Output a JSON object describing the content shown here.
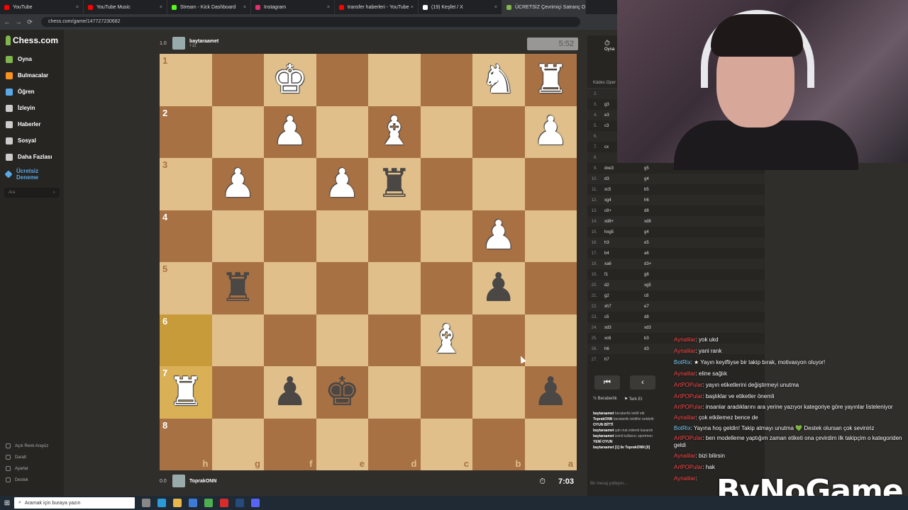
{
  "browser": {
    "tabs": [
      {
        "label": "YouTube",
        "color": "#ff0000"
      },
      {
        "label": "YouTube Music",
        "color": "#ff0000"
      },
      {
        "label": "Stream - Kick Dashboard",
        "color": "#53fc18"
      },
      {
        "label": "Instagram",
        "color": "#e1306c"
      },
      {
        "label": "transfer haberleri - YouTube",
        "color": "#ff0000"
      },
      {
        "label": "(19) Keşfet / X",
        "color": "#ffffff"
      },
      {
        "label": "ÜCRETSİZ Çevrimiçi Satranç Oy...",
        "color": "#81b64c"
      }
    ],
    "url": "chess.com/game/147727230682"
  },
  "sidebar": {
    "logo": "Chess.com",
    "items": [
      {
        "label": "Oyna",
        "color": "#81b64c"
      },
      {
        "label": "Bulmacalar",
        "color": "#f7931e"
      },
      {
        "label": "Öğren",
        "color": "#5aa9e6"
      },
      {
        "label": "İzleyin",
        "color": "#cccccc"
      },
      {
        "label": "Haberler",
        "color": "#cccccc"
      },
      {
        "label": "Sosyal",
        "color": "#cccccc"
      },
      {
        "label": "Daha Fazlası",
        "color": "#cccccc"
      }
    ],
    "trial": "Ücretsiz Deneme",
    "search_placeholder": "Ara",
    "footer": [
      "Açık Renk Arayüz",
      "Daralt",
      "Ayarlar",
      "Destek"
    ]
  },
  "players": {
    "top": {
      "rating": "1.0",
      "name": "baytaraamet",
      "extra": "+11",
      "clock": "5:52"
    },
    "bottom": {
      "rating": "0.0",
      "name": "ToprakONN",
      "clock": "7:03"
    }
  },
  "board": {
    "ranks": [
      "1",
      "2",
      "3",
      "4",
      "5",
      "6",
      "7",
      "8"
    ],
    "files": [
      "h",
      "g",
      "f",
      "e",
      "d",
      "c",
      "b",
      "a"
    ],
    "squares": [
      [
        "",
        "",
        "wK",
        "",
        "",
        "",
        "wN",
        "wR"
      ],
      [
        "",
        "",
        "wP",
        "",
        "wB",
        "",
        "",
        "wP"
      ],
      [
        "",
        "wP",
        "",
        "wP",
        "bR",
        "",
        "",
        ""
      ],
      [
        "",
        "",
        "",
        "",
        "",
        "",
        "wP",
        ""
      ],
      [
        "",
        "bR",
        "",
        "",
        "",
        "",
        "bP",
        ""
      ],
      [
        "",
        "",
        "",
        "",
        "",
        "wB",
        "",
        ""
      ],
      [
        "wR",
        "",
        "bP",
        "bK",
        "",
        "",
        "",
        "bP"
      ],
      [
        "",
        "",
        "",
        "",
        "",
        "",
        "",
        ""
      ]
    ],
    "highlight": [
      [
        5,
        0
      ],
      [
        6,
        0
      ]
    ]
  },
  "moves": {
    "top_label": "Oyna",
    "opening": "Kâdes Oper",
    "rows": [
      {
        "n": "2.",
        "w": "",
        "b": ""
      },
      {
        "n": "3.",
        "w": "g3",
        "b": ""
      },
      {
        "n": "4.",
        "w": "e3",
        "b": ""
      },
      {
        "n": "5.",
        "w": "c3",
        "b": ""
      },
      {
        "n": "6.",
        "w": "",
        "b": ""
      },
      {
        "n": "7.",
        "w": "cx",
        "b": ""
      },
      {
        "n": "8.",
        "w": "",
        "b": ""
      },
      {
        "n": "9.",
        "w": "dxe3",
        "b": "g5"
      },
      {
        "n": "10.",
        "w": "d3",
        "b": "g4"
      },
      {
        "n": "11.",
        "w": "xc5",
        "b": "b5"
      },
      {
        "n": "12.",
        "w": "xg4",
        "b": "h6"
      },
      {
        "n": "13.",
        "w": "c8+",
        "b": "d8"
      },
      {
        "n": "14.",
        "w": "xd8+",
        "b": "xd8"
      },
      {
        "n": "15.",
        "w": "hxg5",
        "b": "g4"
      },
      {
        "n": "16.",
        "w": "h3",
        "b": "e5"
      },
      {
        "n": "17.",
        "w": "b4",
        "b": "a6"
      },
      {
        "n": "18.",
        "w": "xa6",
        "b": "d3+"
      },
      {
        "n": "19.",
        "w": "f1",
        "b": "g8"
      },
      {
        "n": "20.",
        "w": "d2",
        "b": "xg5"
      },
      {
        "n": "21.",
        "w": "g2",
        "b": "c8"
      },
      {
        "n": "22.",
        "w": "xh7",
        "b": "e7"
      },
      {
        "n": "23.",
        "w": "c5",
        "b": "d8"
      },
      {
        "n": "24.",
        "w": "xd3",
        "b": "xd3"
      },
      {
        "n": "25.",
        "w": "xc6",
        "b": "b3"
      },
      {
        "n": "26.",
        "w": "h6",
        "b": "d3"
      },
      {
        "n": "27.",
        "w": "h7",
        "b": ""
      }
    ],
    "nav": [
      "⏮",
      "‹"
    ],
    "actions": [
      "Beraberlik",
      "Terk Et"
    ],
    "log": [
      {
        "user": "baytaraamet",
        "text": "beraberlik teklif etti"
      },
      {
        "user": "ToprakONN",
        "text": "beraberlik teklifini reddetti"
      },
      {
        "user": "OYUN BİTTİ",
        "text": ""
      },
      {
        "user": "baytaraamet",
        "text": "şah mat ederek kazandı"
      },
      {
        "user": "baytaraamet",
        "text": "isimli kullanıcı sportmen"
      },
      {
        "user": "YENİ OYUN",
        "text": ""
      },
      {
        "user": "baytaraamet [1] ile ToprakONN [0]",
        "text": ""
      }
    ],
    "message_placeholder": "Bir mesaj yolleyın..."
  },
  "chat": [
    {
      "user": "Aynalilar",
      "text": ": yok ukd",
      "bot": false
    },
    {
      "user": "Aynalilar",
      "text": ": yani rank",
      "bot": false
    },
    {
      "user": "BotRix",
      "text": ": ★ Yayın keyifliyse bir takip bırak, motivasyon oluyor!",
      "bot": true
    },
    {
      "user": "Aynalilar",
      "text": ": eline sağlık",
      "bot": false
    },
    {
      "user": "ArtPOPular",
      "text": ": yayın etiketlerini değiştirmeyi unutma",
      "bot": false
    },
    {
      "user": "ArtPOPular",
      "text": ": başlıklar ve etiketler önemli",
      "bot": false
    },
    {
      "user": "ArtPOPular",
      "text": ": insanlar aradıklarını ara yerine yazıyor kategoriye göre yayınlar listeleniyor",
      "bot": false
    },
    {
      "user": "Aynalilar",
      "text": ": çok etkilemez bence de",
      "bot": false
    },
    {
      "user": "BotRix",
      "text": ": Yayına hoş geldin! Takip atmayı unutma 💚 Destek olursan çok seviniriz",
      "bot": true
    },
    {
      "user": "ArtPOPular",
      "text": ": ben modelleme yaptığım zaman etiketi ona çevirdim ilk takipçim o kategoriden geldi",
      "bot": false
    },
    {
      "user": "Aynalilar",
      "text": ": bizi bilirsin",
      "bot": false
    },
    {
      "user": "ArtPOPular",
      "text": ": hak",
      "bot": false
    },
    {
      "user": "Aynalilar",
      "text": ": ",
      "bot": false
    }
  ],
  "watermark": "ByNoGame",
  "taskbar": {
    "search": "Aramak için buraya yazın"
  }
}
